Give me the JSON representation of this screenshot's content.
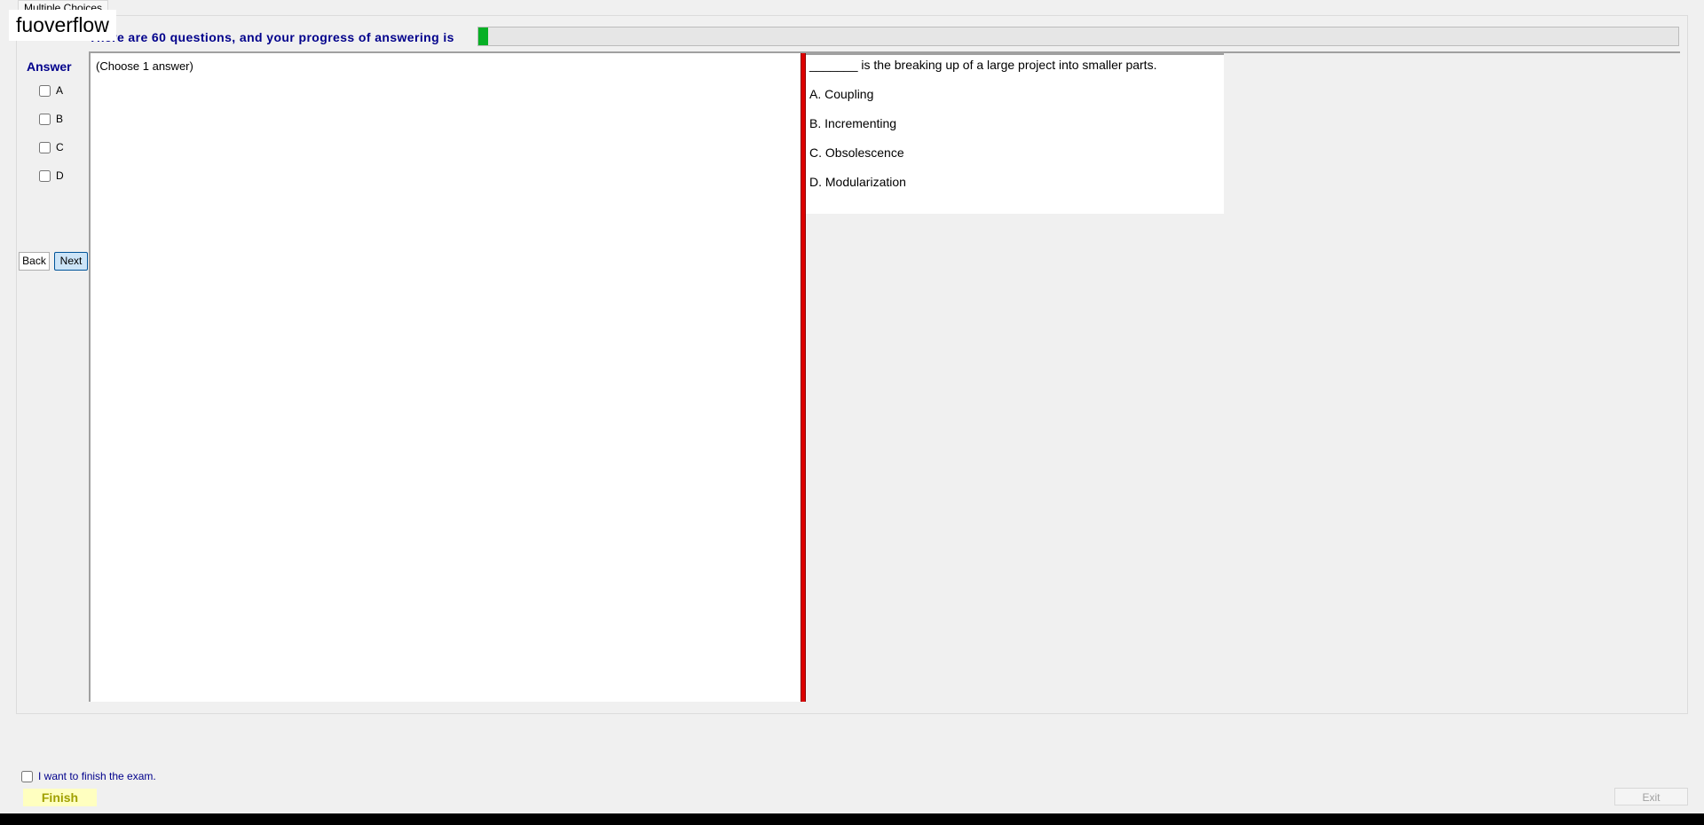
{
  "tab": {
    "label": "Multiple Choices"
  },
  "watermark": "fuoverflow",
  "progress": {
    "text": "There are 60 questions, and your progress of answering is",
    "fraction": 0.008
  },
  "answer_panel": {
    "title": "Answer",
    "options": [
      "A",
      "B",
      "C",
      "D"
    ]
  },
  "nav": {
    "back_label": "Back",
    "next_label": "Next"
  },
  "question": {
    "instruction": "(Choose 1 answer)",
    "text": "_______ is the breaking up of a large project into smaller parts.",
    "choices": [
      "A.  Coupling",
      "B.  Incrementing",
      "C.  Obsolescence",
      "D.  Modularization"
    ]
  },
  "footer": {
    "finish_check_label": "I want to finish the exam.",
    "finish_label": "Finish",
    "exit_label": "Exit"
  },
  "colors": {
    "accent_text": "#00008b",
    "progress_green": "#06b025",
    "splitter_red": "#dd0000",
    "finish_bg": "#ffffc0"
  }
}
